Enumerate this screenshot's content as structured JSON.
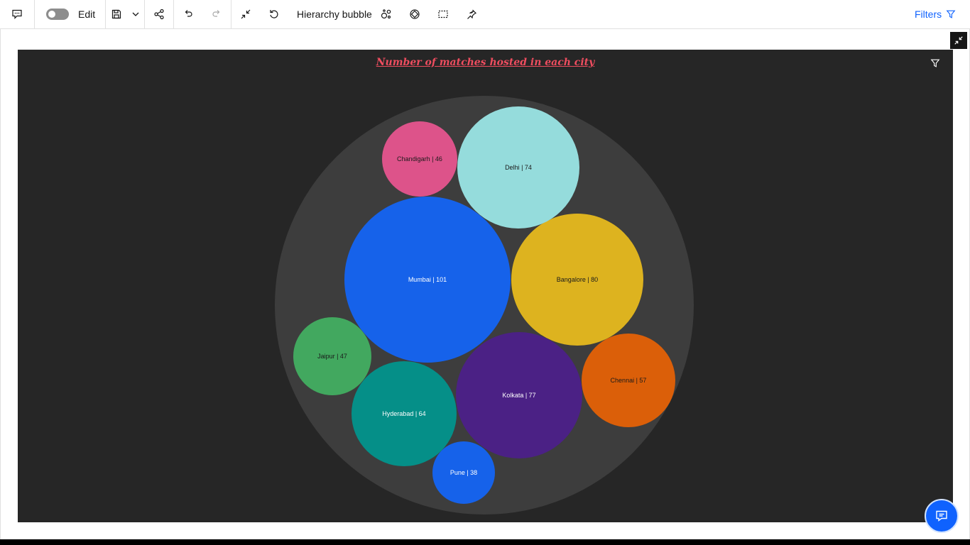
{
  "toolbar": {
    "edit_label": "Edit",
    "viz_title": "Hierarchy bubble",
    "filters_label": "Filters"
  },
  "colors": {
    "accent": "#0f62fe",
    "chart_background": "#262626",
    "outer_bubble": "#3d3d3d",
    "title": "#ee4d5f"
  },
  "chart_data": {
    "type": "bubble",
    "title": "Number of matches hosted in each city",
    "label_format": "{name} | {value}",
    "items": [
      {
        "name": "Mumbai",
        "value": 101,
        "color": "#1662ea",
        "text_color": "#ffffff"
      },
      {
        "name": "Bangalore",
        "value": 80,
        "color": "#ddb31f",
        "text_color": "#1a1a1a"
      },
      {
        "name": "Kolkata",
        "value": 77,
        "color": "#4b2185",
        "text_color": "#ffffff"
      },
      {
        "name": "Delhi",
        "value": 74,
        "color": "#95dcdc",
        "text_color": "#1a1a1a"
      },
      {
        "name": "Hyderabad",
        "value": 64,
        "color": "#058f88",
        "text_color": "#ffffff"
      },
      {
        "name": "Chennai",
        "value": 57,
        "color": "#db5f09",
        "text_color": "#1a1a1a"
      },
      {
        "name": "Jaipur",
        "value": 47,
        "color": "#42a85f",
        "text_color": "#1a1a1a"
      },
      {
        "name": "Chandigarh",
        "value": 46,
        "color": "#dd538a",
        "text_color": "#1a1a1a"
      },
      {
        "name": "Pune",
        "value": 38,
        "color": "#1662ea",
        "text_color": "#ffffff"
      }
    ]
  }
}
